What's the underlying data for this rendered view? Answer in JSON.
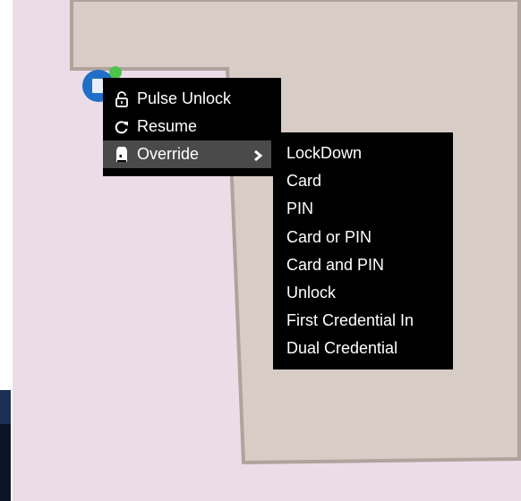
{
  "context_menu": {
    "items": [
      {
        "label": "Pulse Unlock",
        "icon": "unlock-icon"
      },
      {
        "label": "Resume",
        "icon": "refresh-icon"
      },
      {
        "label": "Override",
        "icon": "override-icon",
        "has_submenu": true
      }
    ]
  },
  "override_submenu": {
    "items": [
      {
        "label": "LockDown"
      },
      {
        "label": "Card"
      },
      {
        "label": "PIN"
      },
      {
        "label": "Card or PIN"
      },
      {
        "label": "Card and PIN"
      },
      {
        "label": "Unlock"
      },
      {
        "label": "First Credential In"
      },
      {
        "label": "Dual Credential"
      }
    ]
  },
  "door_marker": {
    "status_color": "#4cc44a",
    "badge_color": "#1f6fc6"
  },
  "colors": {
    "map_background": "#ebdde8",
    "room_fill": "#d8cdc6",
    "room_border": "#b0a29c",
    "menu_background": "#000000",
    "menu_highlight": "#4a4a4a",
    "menu_text": "#ffffff"
  }
}
